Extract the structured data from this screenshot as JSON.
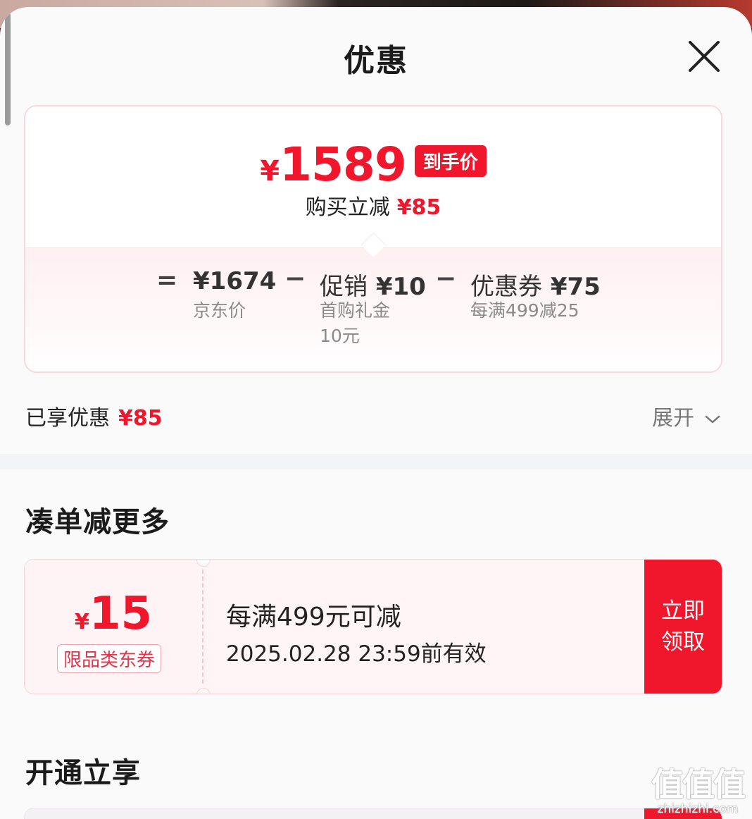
{
  "sheet": {
    "title": "优惠"
  },
  "price_summary": {
    "final_price_symbol": "¥",
    "final_price": "1589",
    "final_price_tag": "到手价",
    "instant_reduction_label": "购买立减",
    "instant_reduction_amount": "¥85",
    "breakdown": {
      "equals": "=",
      "minus": "−",
      "jd_price_value": "¥1674",
      "jd_price_label": "京东价",
      "promo_label": "促销",
      "promo_value": "¥10",
      "promo_desc_line1": "首购礼金",
      "promo_desc_line2": "10元",
      "coupon_label": "优惠券",
      "coupon_value": "¥75",
      "coupon_desc": "每满499减25"
    }
  },
  "enjoyed": {
    "label": "已享优惠",
    "amount": "¥85",
    "expand_label": "展开"
  },
  "sections": {
    "combine_title": "凑单减更多",
    "membership_title": "开通立享"
  },
  "coupon": {
    "symbol": "¥",
    "amount": "15",
    "tag": "限品类东券",
    "condition": "每满499元可减",
    "validity": "2025.02.28 23:59前有效",
    "claim_line1": "立即",
    "claim_line2": "领取"
  },
  "watermark": {
    "logo": "值值值",
    "url": "zhizhizhi.com"
  },
  "colors": {
    "accent": "#f0162c",
    "sheet_bg": "#fbfafb",
    "coupon_bg": "#fff5f6"
  },
  "icons": {
    "close": "close-icon",
    "expand": "chevron-down-icon"
  }
}
